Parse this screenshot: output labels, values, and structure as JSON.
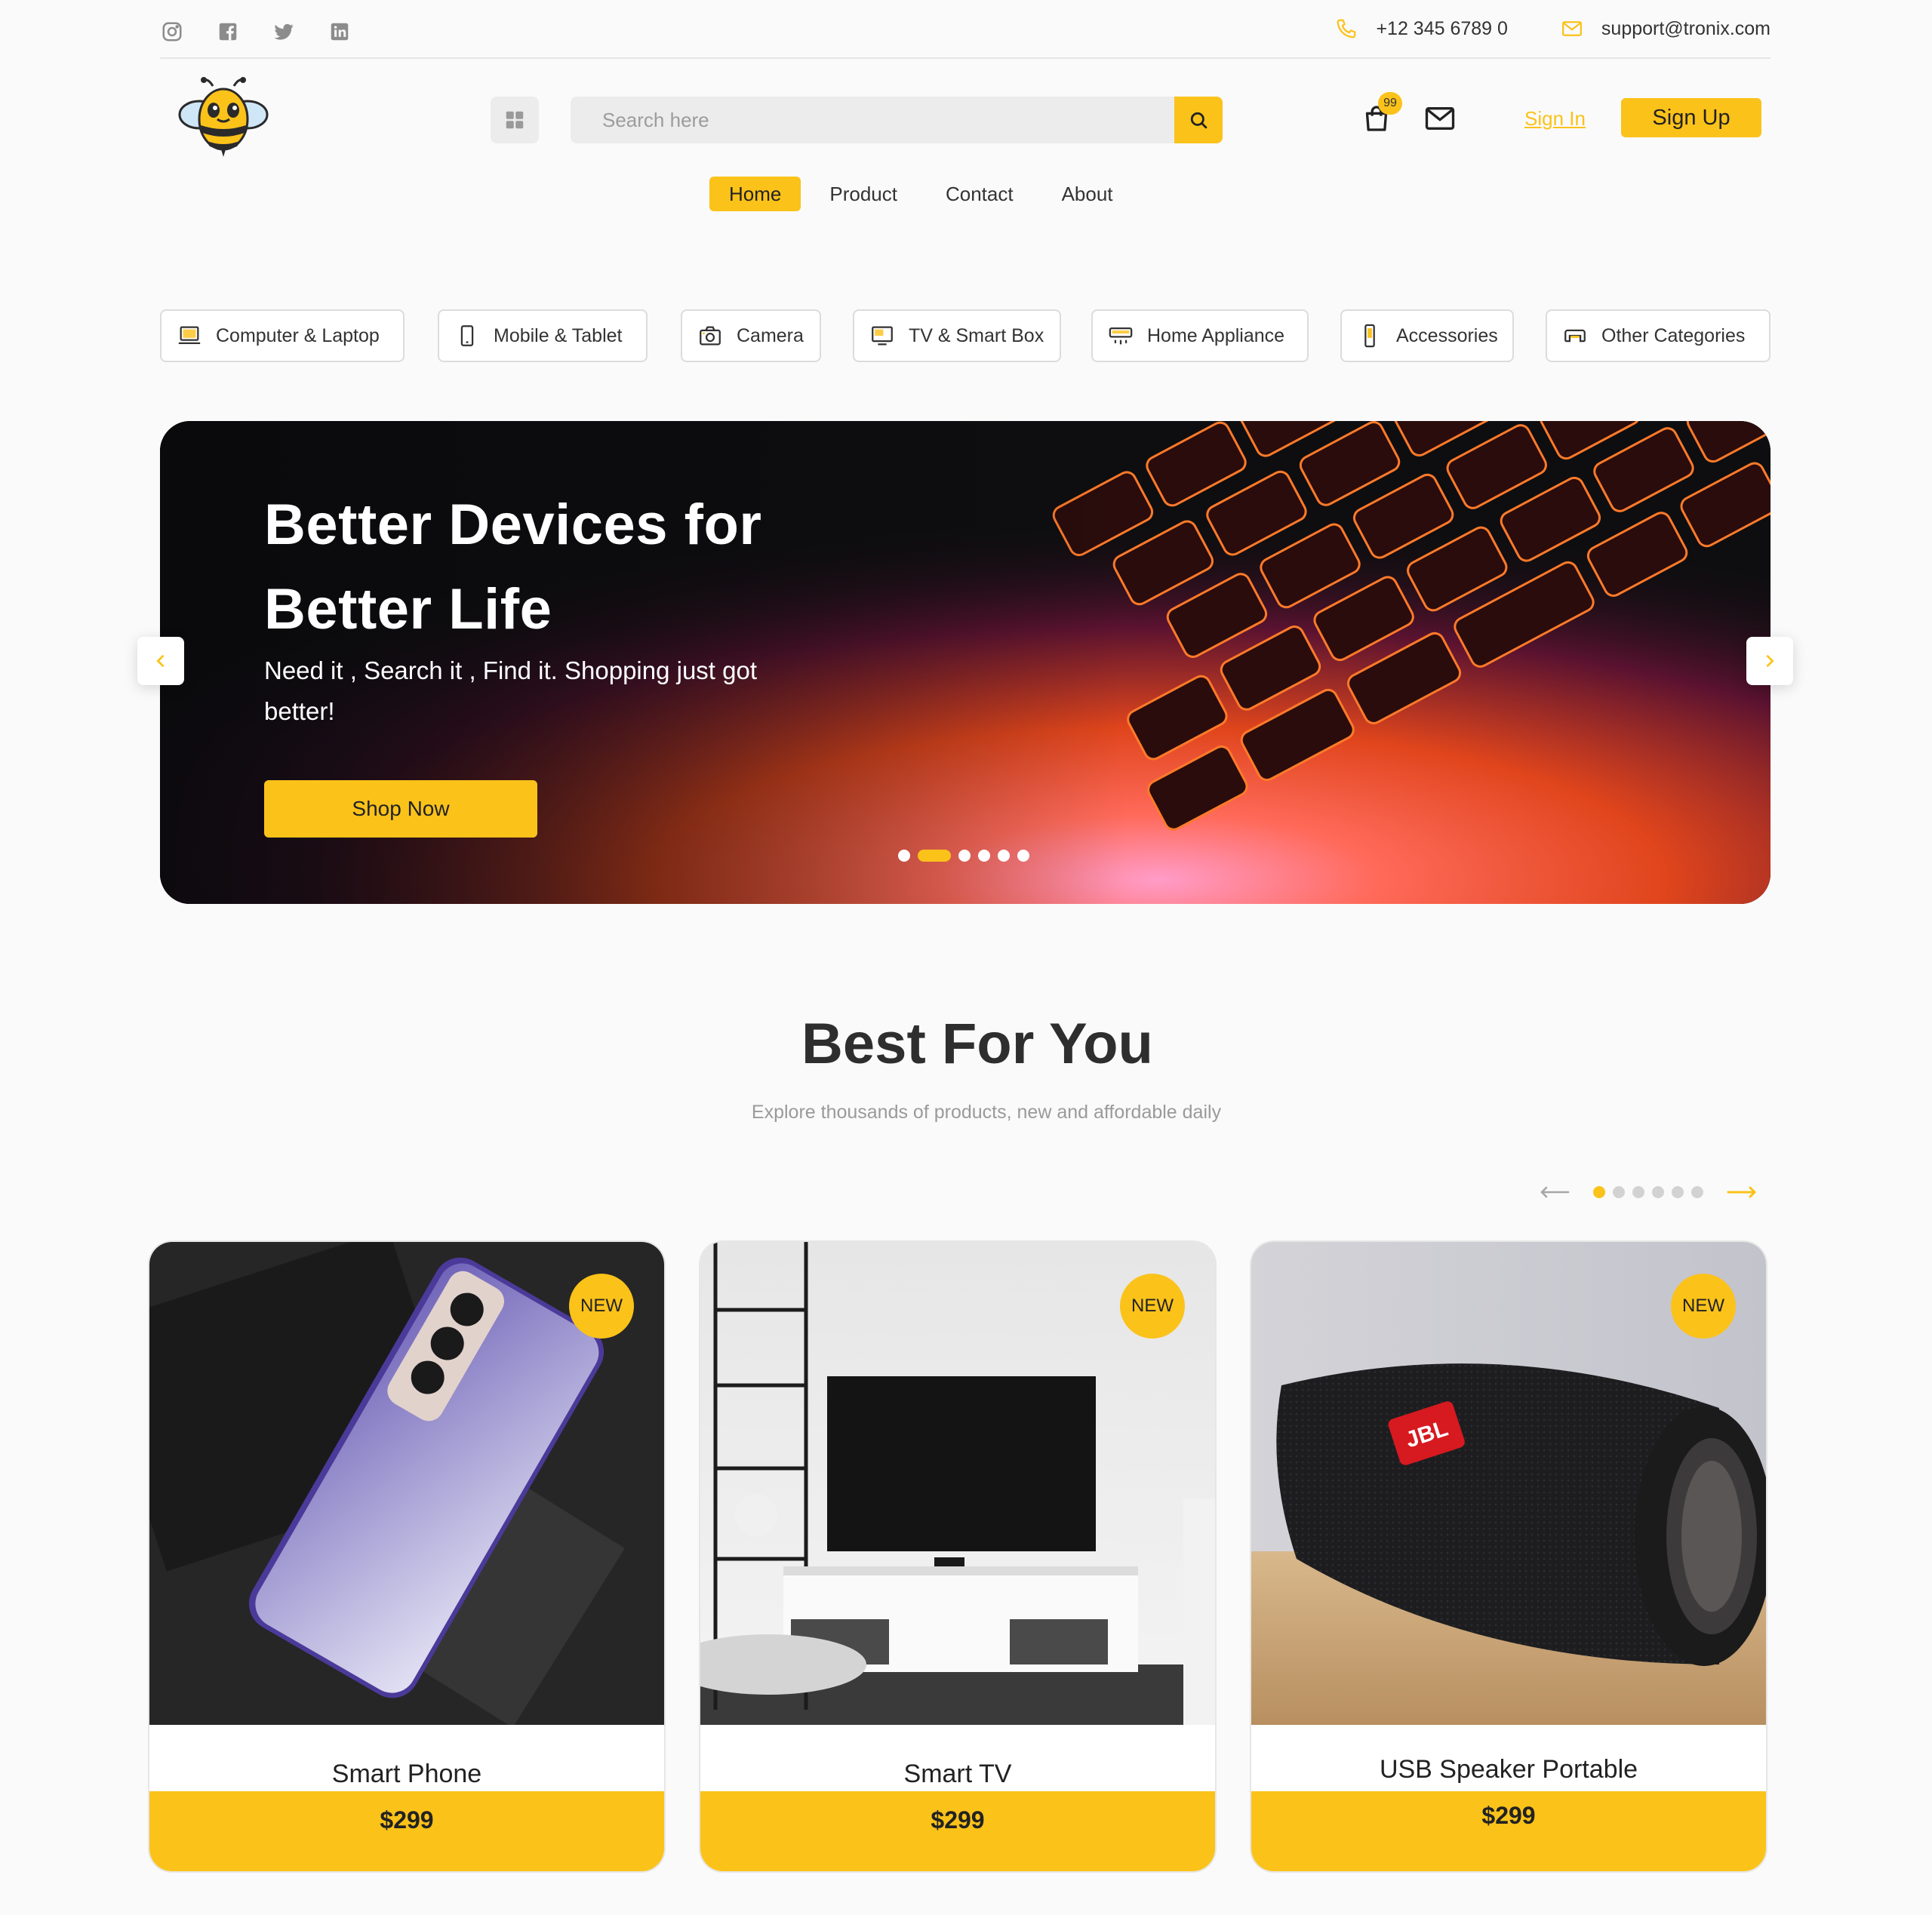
{
  "topbar": {
    "socials": [
      "instagram-icon",
      "facebook-icon",
      "twitter-icon",
      "linkedin-icon"
    ],
    "phone": "+12 345 6789 0",
    "email": "support@tronix.com"
  },
  "header": {
    "search_placeholder": "Search here",
    "cart_count": "99",
    "signin_label": "Sign In",
    "signup_label": "Sign Up"
  },
  "nav": {
    "items": [
      {
        "label": "Home",
        "active": true
      },
      {
        "label": "Product",
        "active": false
      },
      {
        "label": "Contact",
        "active": false
      },
      {
        "label": "About",
        "active": false
      }
    ]
  },
  "categories": [
    {
      "label": "Computer & Laptop",
      "icon": "laptop-icon"
    },
    {
      "label": "Mobile & Tablet",
      "icon": "mobile-icon"
    },
    {
      "label": "Camera",
      "icon": "camera-icon"
    },
    {
      "label": "TV & Smart Box",
      "icon": "tv-icon"
    },
    {
      "label": "Home Appliance",
      "icon": "appliance-icon"
    },
    {
      "label": "Accessories",
      "icon": "accessories-icon"
    },
    {
      "label": "Other Categories",
      "icon": "categories-icon"
    }
  ],
  "hero": {
    "title_line1": "Better Devices for",
    "title_line2": "Better Life",
    "subtitle": "Need it , Search it , Find it. Shopping just got better!",
    "cta_label": "Shop Now",
    "slide_count": 6,
    "active_slide": 2
  },
  "best": {
    "title": "Best For You",
    "subtitle": "Explore thousands of products, new and affordable daily",
    "page_count": 6,
    "active_page": 1
  },
  "products": [
    {
      "name": "Smart Phone",
      "price": "$299",
      "badge": "NEW"
    },
    {
      "name": "Smart TV",
      "price": "$299",
      "badge": "NEW"
    },
    {
      "name": "USB Speaker Portable",
      "price": "$299",
      "badge": "NEW"
    }
  ],
  "colors": {
    "accent": "#fbc21a",
    "text": "#2b2b2b",
    "muted": "#9a9a9a",
    "background": "#fafafa"
  }
}
